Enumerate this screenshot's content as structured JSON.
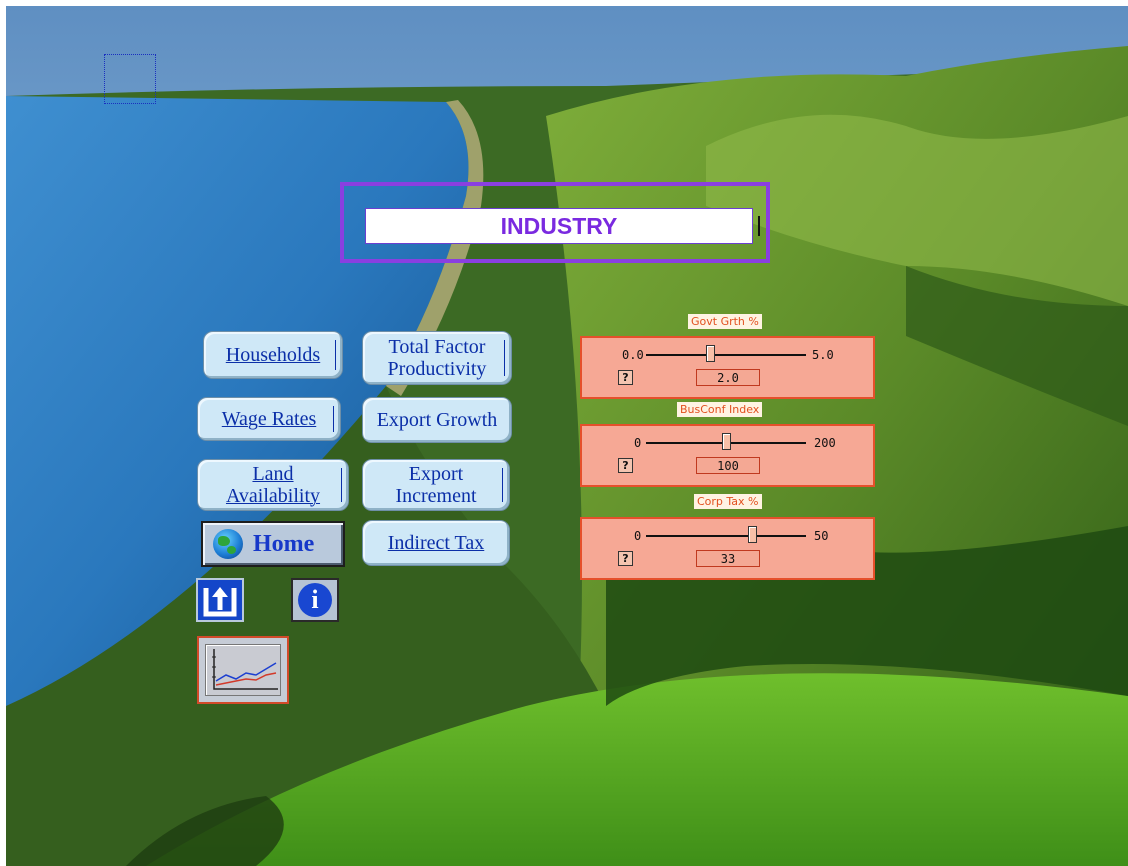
{
  "header": {
    "title": "INDUSTRY"
  },
  "nav": {
    "households": "Households",
    "total_factor_productivity": "Total Factor Productivity",
    "wage_rates": "Wage Rates",
    "export_growth": "Export Growth",
    "land_availability": "Land Availability",
    "export_increment": "Export Increment",
    "indirect_tax": "Indirect Tax",
    "home": "Home"
  },
  "icons": {
    "home": "globe-icon",
    "up": "up-arrow-icon",
    "info": "info-icon",
    "chart": "line-chart-icon"
  },
  "info_glyph": "i",
  "sliders": [
    {
      "label": "Govt Grth %",
      "min": "0.0",
      "max": "5.0",
      "value": "2.0",
      "fraction": 0.4,
      "help": "?"
    },
    {
      "label": "BusConf Index",
      "min": "0",
      "max": "200",
      "value": "100",
      "fraction": 0.5,
      "help": "?"
    },
    {
      "label": "Corp Tax %",
      "min": "0",
      "max": "50",
      "value": "33",
      "fraction": 0.66,
      "help": "?"
    }
  ],
  "colors": {
    "title_text": "#7a2ae0",
    "title_border": "#8a3fe0",
    "slider_panel": "#f6a895",
    "slider_border": "#e5502b",
    "nav_text": "#0b2fa8"
  }
}
